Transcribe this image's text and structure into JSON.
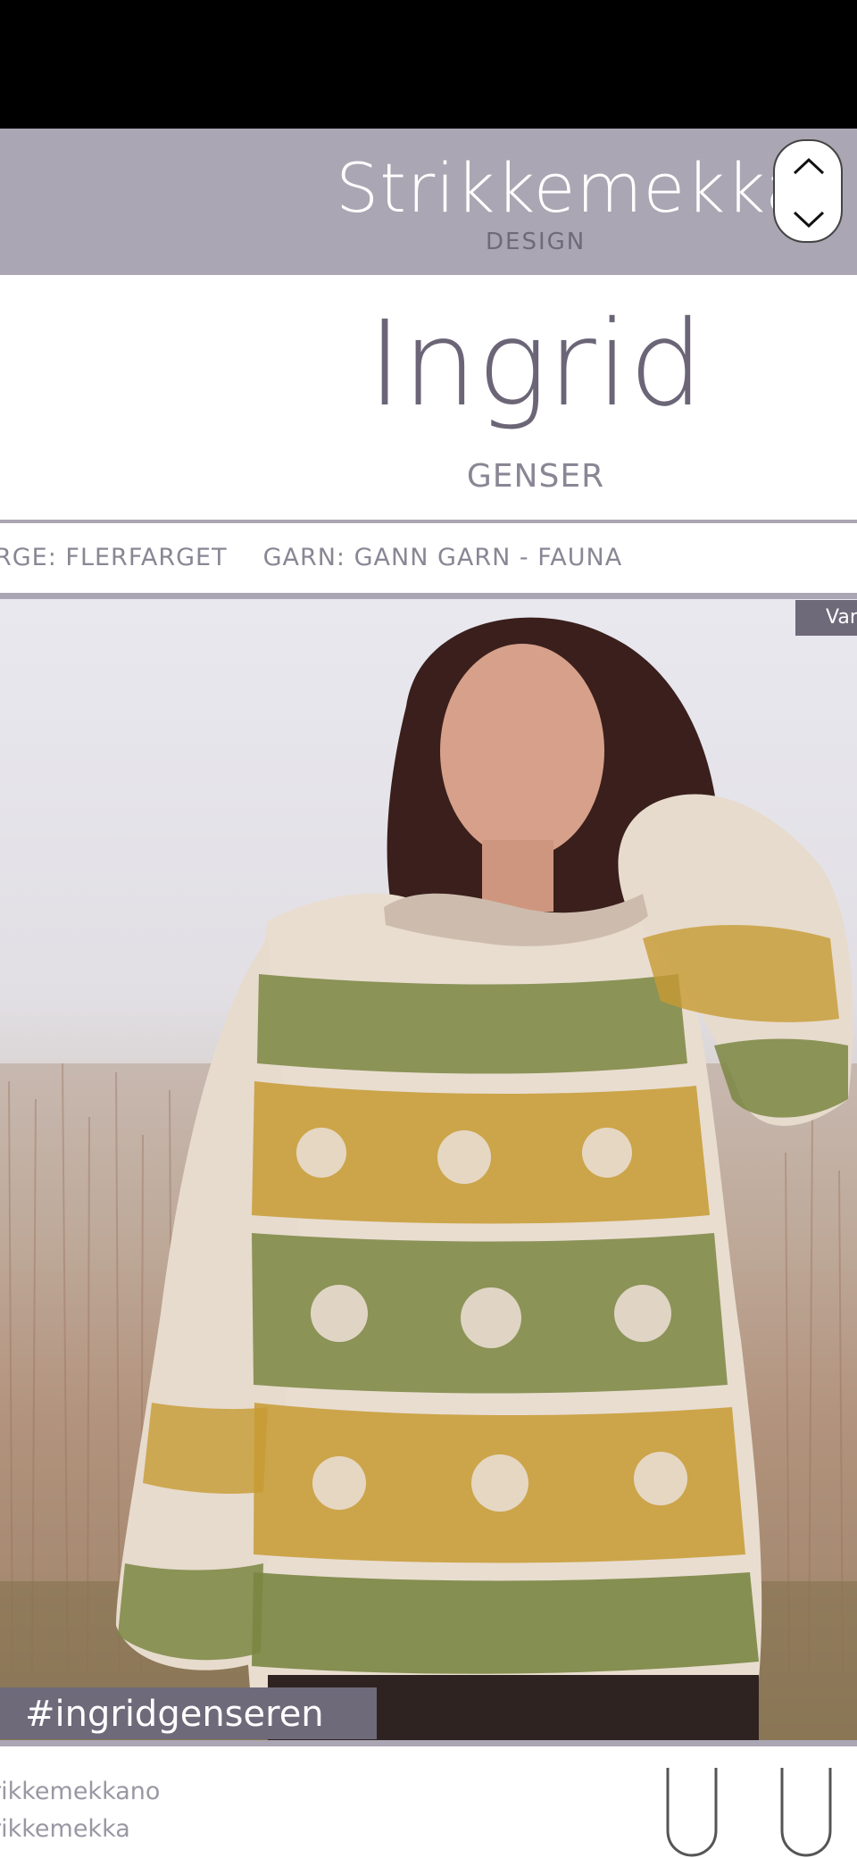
{
  "brand": {
    "name": "Strikkemekka",
    "subtitle": "DESIGN"
  },
  "pattern": {
    "name": "Ingrid",
    "type": "GENSER"
  },
  "info_strip": {
    "color_text": "RGE: FLERFARGET",
    "yarn_text": "GARN: GANN GARN - FAUNA"
  },
  "corner_tab": {
    "label": "Van"
  },
  "hashtag": "#ingridgenseren",
  "footer": {
    "social_1": "rikkemekkano",
    "social_2": "rikkemekka"
  },
  "colors": {
    "header_bg": "#aaa6b3",
    "accent_dark": "#6e6a7a",
    "title_text": "#6b6577",
    "sweater_cream": "#e9ddd0",
    "sweater_olive": "#7a8642",
    "sweater_mustard": "#c79b33"
  },
  "icons": {
    "nav_up": "chevron-up-icon",
    "nav_down": "chevron-down-icon",
    "hanger": "hanger-icon"
  }
}
